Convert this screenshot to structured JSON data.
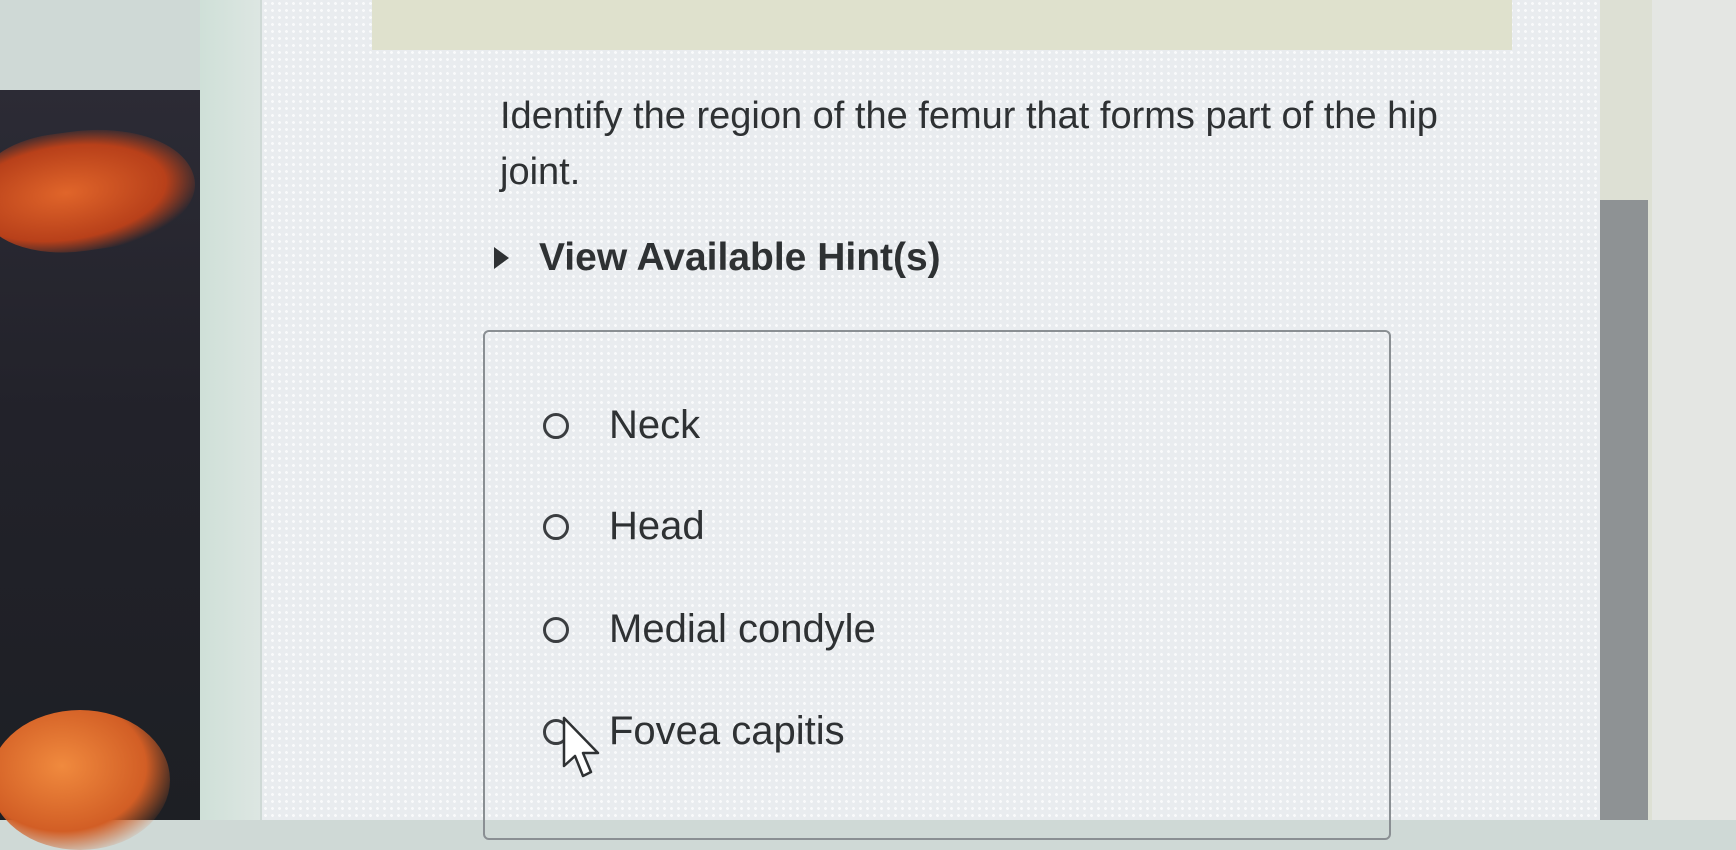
{
  "question": {
    "text": "Identify the region of the femur that forms part of the hip joint."
  },
  "hint": {
    "toggle_icon": "caret-right-icon",
    "label": "View Available Hint(s)"
  },
  "answer_options": [
    {
      "label": "Neck",
      "selected": false
    },
    {
      "label": "Head",
      "selected": false
    },
    {
      "label": "Medial condyle",
      "selected": false
    },
    {
      "label": "Fovea capitis",
      "selected": false
    }
  ],
  "pointer": {
    "icon": "mouse-pointer-icon"
  },
  "colors": {
    "text": "#2e3133",
    "border": "#8a8f93",
    "background": "#e9ecef"
  }
}
